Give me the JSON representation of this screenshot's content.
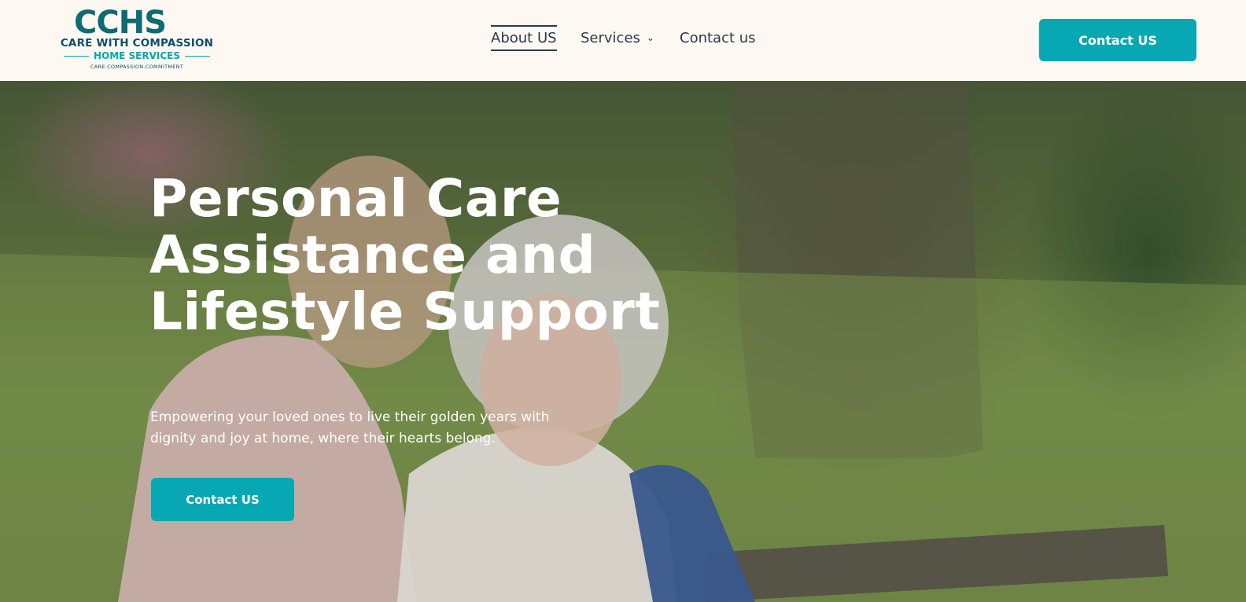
{
  "logo": {
    "mark": "CCHS",
    "line1": "CARE WITH COMPASSION",
    "line2": "HOME SERVICES",
    "tagline": "CARE.COMPASSION.COMMITMENT"
  },
  "nav": {
    "items": [
      {
        "label": "About US",
        "active": true
      },
      {
        "label": "Services",
        "has_dropdown": true,
        "icon": "chevron-down-icon"
      },
      {
        "label": "Contact us"
      }
    ]
  },
  "header_cta": {
    "label": "Contact US"
  },
  "hero": {
    "title_lines": [
      "Personal Care",
      "Assistance and",
      "Lifestyle Support"
    ],
    "subtitle": "Empowering your loved ones to live their golden years with dignity and joy at home, where their hearts belong.",
    "cta_label": "Contact US"
  },
  "colors": {
    "accent": "#07a8b3",
    "header_bg": "#fdf8f2",
    "nav_text": "#2b3a4a",
    "logo_dark": "#0c4f6b",
    "logo_teal": "#0fa3ad"
  }
}
